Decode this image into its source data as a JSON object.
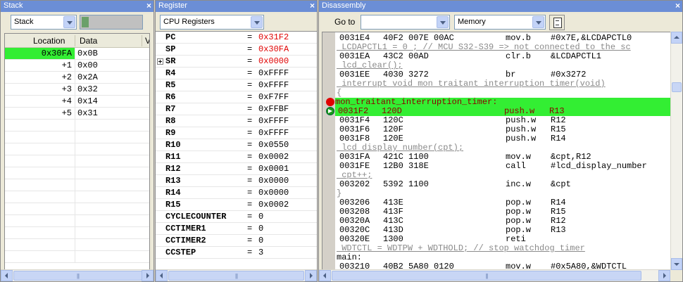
{
  "stack": {
    "title": "Stack",
    "selector_value": "Stack",
    "headers": {
      "location": "Location",
      "data": "Data",
      "extra": "V"
    },
    "rows": [
      {
        "location": "0x30FA",
        "data": "0x0B",
        "highlight": true
      },
      {
        "location": "+1",
        "data": "0x00"
      },
      {
        "location": "+2",
        "data": "0x2A"
      },
      {
        "location": "+3",
        "data": "0x32"
      },
      {
        "location": "+4",
        "data": "0x14"
      },
      {
        "location": "+5",
        "data": "0x31"
      }
    ],
    "highlight_color": "#33ee33"
  },
  "register": {
    "title": "Register",
    "selector_value": "CPU Registers",
    "rows": [
      {
        "name": "PC",
        "value": "0x31F2",
        "changed": true
      },
      {
        "name": "SP",
        "value": "0x30FA",
        "changed": true
      },
      {
        "name": "SR",
        "value": "0x0000",
        "changed": true,
        "expandable": true
      },
      {
        "name": "R4",
        "value": "0xFFFF"
      },
      {
        "name": "R5",
        "value": "0xFFFF"
      },
      {
        "name": "R6",
        "value": "0xF7FF"
      },
      {
        "name": "R7",
        "value": "0xFFBF"
      },
      {
        "name": "R8",
        "value": "0xFFFF"
      },
      {
        "name": "R9",
        "value": "0xFFFF"
      },
      {
        "name": "R10",
        "value": "0x0550"
      },
      {
        "name": "R11",
        "value": "0x0002"
      },
      {
        "name": "R12",
        "value": "0x0001"
      },
      {
        "name": "R13",
        "value": "0x0000"
      },
      {
        "name": "R14",
        "value": "0x0000"
      },
      {
        "name": "R15",
        "value": "0x0002"
      },
      {
        "name": "CYCLECOUNTER",
        "value": "0"
      },
      {
        "name": "CCTIMER1",
        "value": "0"
      },
      {
        "name": "CCTIMER2",
        "value": "0"
      },
      {
        "name": "CCSTEP",
        "value": "3"
      }
    ],
    "equals": "=",
    "changed_color": "#e00000"
  },
  "disassembly": {
    "title": "Disassembly",
    "goto_label": "Go to",
    "goto_value": "",
    "memory_value": "Memory",
    "lines": [
      {
        "kind": "code",
        "addr": "0031E4",
        "bytes": "40F2 007E 00AC",
        "mnem": "mov.b",
        "ops": "#0x7E,&LCDAPCTL0"
      },
      {
        "kind": "src",
        "text": " LCDAPCTL1 = 0 ; // MCU S32-S39 => not connected to the sc"
      },
      {
        "kind": "code",
        "addr": "0031EA",
        "bytes": "43C2 00AD",
        "mnem": "clr.b",
        "ops": "&LCDAPCTL1"
      },
      {
        "kind": "src",
        "text": " lcd_clear();"
      },
      {
        "kind": "code",
        "addr": "0031EE",
        "bytes": "4030 3272",
        "mnem": "br",
        "ops": "#0x3272"
      },
      {
        "kind": "src",
        "text": " interrupt void mon traitant interruption timer(void)"
      },
      {
        "kind": "brace",
        "text": "{"
      },
      {
        "kind": "label",
        "text": "mon_traitant_interruption_timer:"
      },
      {
        "kind": "code",
        "addr": "0031F2",
        "bytes": "120D",
        "mnem": "push.w",
        "ops": "R13",
        "current": true
      },
      {
        "kind": "code",
        "addr": "0031F4",
        "bytes": "120C",
        "mnem": "push.w",
        "ops": "R12"
      },
      {
        "kind": "code",
        "addr": "0031F6",
        "bytes": "120F",
        "mnem": "push.w",
        "ops": "R15"
      },
      {
        "kind": "code",
        "addr": "0031F8",
        "bytes": "120E",
        "mnem": "push.w",
        "ops": "R14"
      },
      {
        "kind": "src",
        "text": " lcd display number(cpt);"
      },
      {
        "kind": "code",
        "addr": "0031FA",
        "bytes": "421C 1100",
        "mnem": "mov.w",
        "ops": "&cpt,R12"
      },
      {
        "kind": "code",
        "addr": "0031FE",
        "bytes": "12B0 318E",
        "mnem": "call",
        "ops": "#lcd_display_number"
      },
      {
        "kind": "src",
        "text": " cpt++;"
      },
      {
        "kind": "code",
        "addr": "003202",
        "bytes": "5392 1100",
        "mnem": "inc.w",
        "ops": "&cpt"
      },
      {
        "kind": "brace",
        "text": "}"
      },
      {
        "kind": "code",
        "addr": "003206",
        "bytes": "413E",
        "mnem": "pop.w",
        "ops": "R14"
      },
      {
        "kind": "code",
        "addr": "003208",
        "bytes": "413F",
        "mnem": "pop.w",
        "ops": "R15"
      },
      {
        "kind": "code",
        "addr": "00320A",
        "bytes": "413C",
        "mnem": "pop.w",
        "ops": "R12"
      },
      {
        "kind": "code",
        "addr": "00320C",
        "bytes": "413D",
        "mnem": "pop.w",
        "ops": "R13"
      },
      {
        "kind": "code",
        "addr": "00320E",
        "bytes": "1300",
        "mnem": "reti",
        "ops": ""
      },
      {
        "kind": "src",
        "text": " WDTCTL = WDTPW + WDTHOLD; // stop watchdog timer"
      },
      {
        "kind": "label2",
        "text": "main:"
      },
      {
        "kind": "code",
        "addr": "003210",
        "bytes": "40B2 5A80 0120",
        "mnem": "mov.w",
        "ops": "#0x5A80,&WDTCTL"
      }
    ],
    "highlight_color": "#33ee33"
  }
}
